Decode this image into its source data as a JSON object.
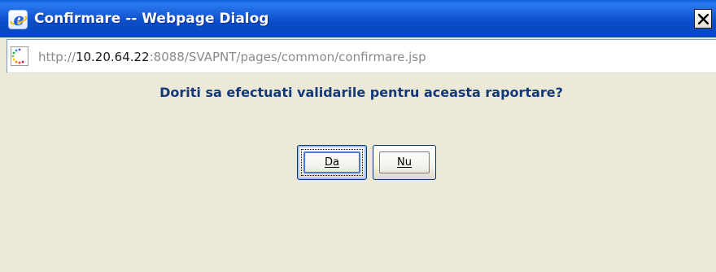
{
  "window": {
    "title": "Confirmare -- Webpage Dialog",
    "close_glyph": "×"
  },
  "address": {
    "scheme": "http://",
    "host": "10.20.64.22",
    "rest": ":8088/SVAPNT/pages/common/confirmare.jsp"
  },
  "dialog": {
    "question": "Doriti sa efectuati validarile pentru aceasta raportare?",
    "buttons": {
      "yes_label": "Da",
      "no_label": "Nu"
    }
  },
  "colors": {
    "titlebar": "#0a4cc8",
    "question_text": "#123a7a",
    "background": "#ece9d8"
  },
  "icons": {
    "title": "ie-logo-icon",
    "page": "loading-page-icon",
    "close": "close-icon"
  }
}
